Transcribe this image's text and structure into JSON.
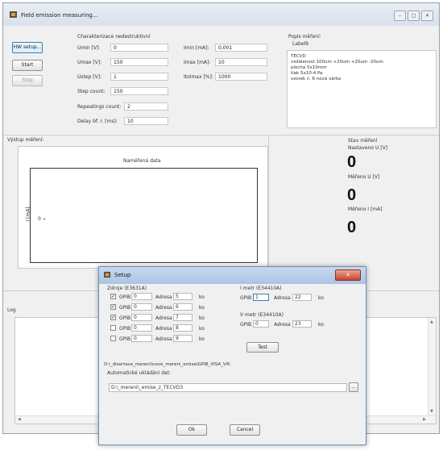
{
  "window": {
    "title": "Field emission measuring...",
    "controls": {
      "minimize": "–",
      "maximize": "□",
      "close": "✕"
    }
  },
  "left_buttons": {
    "hw_setup": "HW setup...",
    "start": "Start",
    "stop": "Stop"
  },
  "characterization": {
    "header": "Charakterizace nedestruktivní",
    "params": [
      {
        "label": "Umin [V]:",
        "value": "0"
      },
      {
        "label": "Umax [V]:",
        "value": "150"
      },
      {
        "label": "Ustep [V]:",
        "value": "1"
      },
      {
        "label": "Step count:",
        "value": "150"
      },
      {
        "label": "Repeatings count:",
        "value": "2"
      },
      {
        "label": "Delay bf. r. [ms]:",
        "value": "10"
      }
    ],
    "current": [
      {
        "label": "Imin [mA]:",
        "value": "0,001"
      },
      {
        "label": "Imax [mA]:",
        "value": "10"
      },
      {
        "label": "Itolmax [%]:",
        "value": "1000"
      }
    ]
  },
  "description": {
    "header": "Popis měření:",
    "label": "Label9",
    "lines": [
      "TECVD",
      "vzdálenost 100um +20um +20um -20um",
      "plocha 5x10mm",
      "tlak 5x10-4 Pa",
      "vzorek č. 6 nová várka"
    ]
  },
  "output": {
    "header": "Výstup měření:",
    "chart_title": "Naměřená data",
    "y_axis_label": "I [mA]",
    "y_tick": "0"
  },
  "status": {
    "header": "Stav měření",
    "items": [
      {
        "label": "Nastaveno U [V]",
        "value": "0"
      },
      {
        "label": "Měřeno U [V]",
        "value": "0"
      },
      {
        "label": "Měřeno I [mA]",
        "value": "0"
      }
    ]
  },
  "log": {
    "header": "Log"
  },
  "setup_dialog": {
    "title": "Setup",
    "sources": {
      "header": "Zdroje (E3631A)",
      "rows": [
        {
          "checked": true,
          "gpib_label": "GPIB",
          "gpib": "0",
          "addr_label": "Adresa",
          "addr": "5",
          "suffix": "ko"
        },
        {
          "checked": true,
          "gpib_label": "GPIB",
          "gpib": "0",
          "addr_label": "Adresa",
          "addr": "6",
          "suffix": "ko"
        },
        {
          "checked": true,
          "gpib_label": "GPIB",
          "gpib": "0",
          "addr_label": "Adresa",
          "addr": "7",
          "suffix": "ko"
        },
        {
          "checked": false,
          "gpib_label": "GPIB",
          "gpib": "0",
          "addr_label": "Adresa",
          "addr": "8",
          "suffix": "ko"
        },
        {
          "checked": false,
          "gpib_label": "GPIB",
          "gpib": "0",
          "addr_label": "Adresa",
          "addr": "9",
          "suffix": "ko"
        }
      ]
    },
    "i_meter": {
      "header": "I metr (E34410A)",
      "gpib_label": "GPIB",
      "gpib": "1",
      "addr_label": "Adresa",
      "addr": "22",
      "suffix": "ko"
    },
    "v_meter": {
      "header": "V metr (E34410A)",
      "gpib_label": "GPIB",
      "gpib": "0",
      "addr_label": "Adresa",
      "addr": "23",
      "suffix": "ko"
    },
    "test_button": "Test",
    "path": "D:\\_disertace_mereni\\nove_mereni_emise\\GPIB_VISA_V4\\",
    "autosave_label": "Automatické ukládání dat:",
    "autosave_path": "D:\\_mereni\\_emise_z_TECVD3",
    "browse_button": "...",
    "ok_button": "Ok",
    "cancel_button": "Cancel",
    "close_glyph": "✕"
  }
}
